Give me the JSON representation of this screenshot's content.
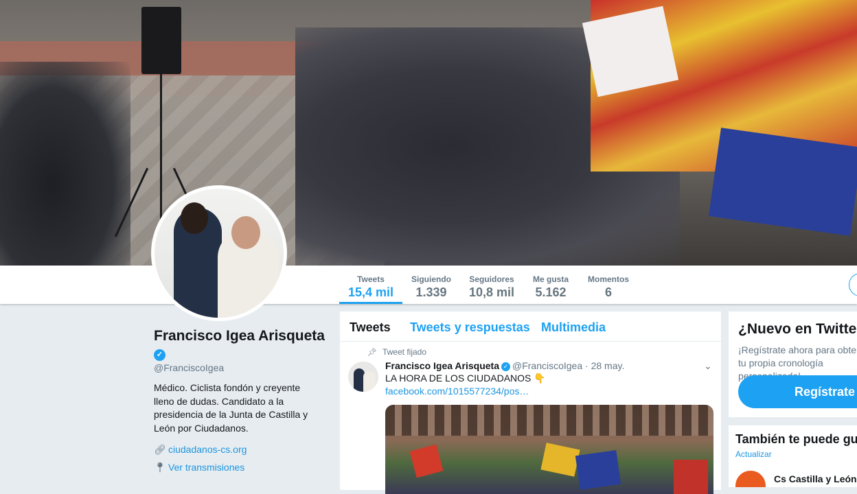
{
  "profile": {
    "name": "Francisco Igea Arisqueta",
    "handle": "@FranciscoIgea",
    "bio": "Médico. Ciclista fondón y creyente lleno de dudas. Candidato a la presidencia de la Junta de Castilla y León por Ciudadanos.",
    "website": "ciudadanos-cs.org",
    "broadcasts": "Ver transmisiones"
  },
  "stats": [
    {
      "label": "Tweets",
      "value": "15,4 mil"
    },
    {
      "label": "Siguiendo",
      "value": "1.339"
    },
    {
      "label": "Seguidores",
      "value": "10,8 mil"
    },
    {
      "label": "Me gusta",
      "value": "5.162"
    },
    {
      "label": "Momentos",
      "value": "6"
    }
  ],
  "timeline": {
    "tabs": [
      "Tweets",
      "Tweets y respuestas",
      "Multimedia"
    ],
    "pinned_label": "Tweet fijado",
    "tweet": {
      "name": "Francisco Igea Arisqueta",
      "handle": "@FranciscoIgea",
      "date": "· 28 may.",
      "text": "LA HORA DE LOS CIUDADANOS 👇",
      "link": "facebook.com/1015577234/pos…"
    }
  },
  "signup": {
    "title": "¿Nuevo en Twitter?",
    "subtitle": "¡Regístrate ahora para obtener tu propia cronología personalizada!",
    "button": "Regístrate"
  },
  "who_to_follow": {
    "title": "También te puede gustar",
    "refresh": "Actualizar",
    "account_name": "Cs Castilla y León"
  },
  "colors": {
    "accent": "#1da1f2",
    "link": "#1b95e0",
    "background": "#e6ecf0"
  }
}
